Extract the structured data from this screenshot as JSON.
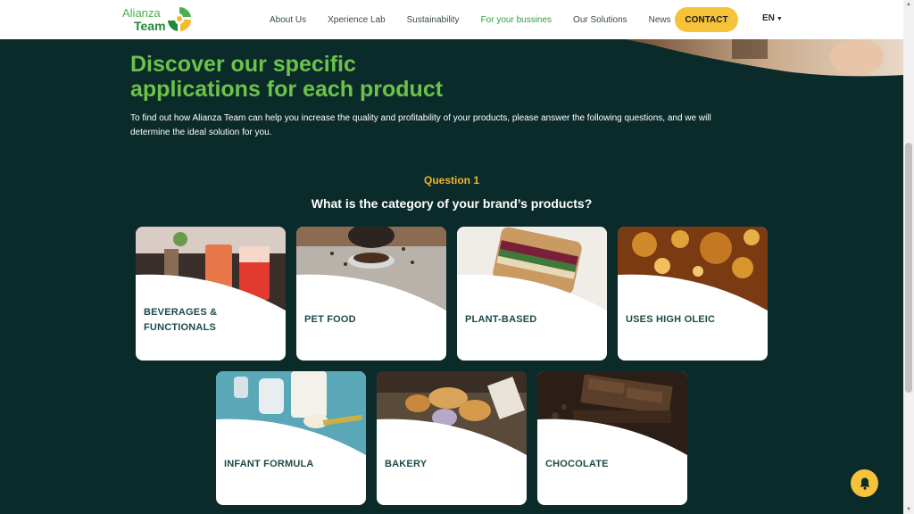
{
  "header": {
    "logo": {
      "line1": "Alianza",
      "line2": "Team"
    },
    "nav": [
      {
        "label": "About Us",
        "active": false
      },
      {
        "label": "Xperience Lab",
        "active": false
      },
      {
        "label": "Sustainability",
        "active": false
      },
      {
        "label": "For your bussines",
        "active": true
      },
      {
        "label": "Our Solutions",
        "active": false
      },
      {
        "label": "News",
        "active": false
      }
    ],
    "contact_label": "CONTACT",
    "language": "EN"
  },
  "intro": {
    "headline_line1": "Discover our specific",
    "headline_line2": "applications for each product",
    "body": "To find out how Alianza Team can help you increase the quality and profitability of your products, please answer the following questions, and we will determine the ideal solution for you."
  },
  "question": {
    "label": "Question 1",
    "text": "What is the category of your brand’s products?"
  },
  "categories": [
    {
      "line1": "BEVERAGES &",
      "line2": "FUNCTIONALS",
      "icon": "beverages-photo"
    },
    {
      "line1": "PET FOOD",
      "line2": "",
      "icon": "pet-food-photo"
    },
    {
      "line1": "PLANT-BASED",
      "line2": "",
      "icon": "plant-based-photo"
    },
    {
      "line1": "USES HIGH OLEIC",
      "line2": "",
      "icon": "oil-photo"
    },
    {
      "line1": "INFANT FORMULA",
      "line2": "",
      "icon": "infant-formula-photo"
    },
    {
      "line1": "BAKERY",
      "line2": "",
      "icon": "bakery-photo"
    },
    {
      "line1": "CHOCOLATE",
      "line2": "",
      "icon": "chocolate-photo"
    }
  ],
  "colors": {
    "background": "#0b2b2b",
    "headline_green": "#6cc24a",
    "accent_yellow": "#f5c23a",
    "question_gold": "#f0b429",
    "card_label": "#1e4a4a"
  }
}
